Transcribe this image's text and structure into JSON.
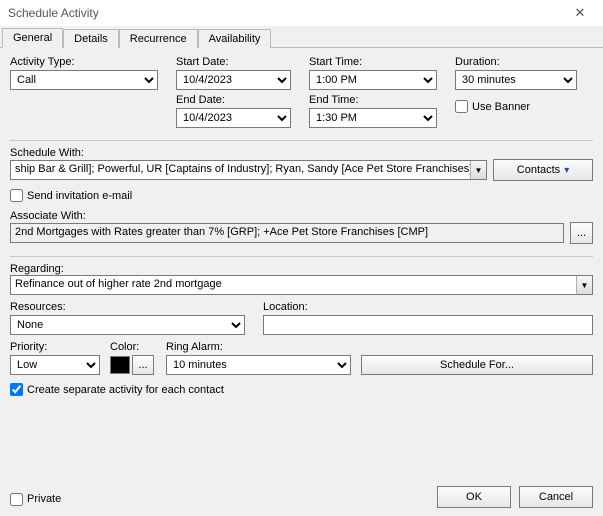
{
  "window": {
    "title": "Schedule Activity",
    "close": "✕"
  },
  "tabs": [
    "General",
    "Details",
    "Recurrence",
    "Availability"
  ],
  "fields": {
    "activity_type": {
      "label": "Activity Type:",
      "value": "Call"
    },
    "start_date": {
      "label": "Start Date:",
      "value": "10/4/2023"
    },
    "end_date": {
      "label": "End Date:",
      "value": "10/4/2023"
    },
    "start_time": {
      "label": "Start Time:",
      "value": "1:00 PM"
    },
    "end_time": {
      "label": "End Time:",
      "value": "1:30 PM"
    },
    "duration": {
      "label": "Duration:",
      "value": "30 minutes"
    },
    "use_banner": {
      "label": "Use Banner"
    },
    "schedule_with": {
      "label": "Schedule With:",
      "value": "ship Bar & Grill]; Powerful, UR [Captains of Industry]; Ryan, Sandy [Ace Pet Store Franchises]",
      "button": "Contacts"
    },
    "send_invite": {
      "label": "Send invitation e-mail"
    },
    "associate_with": {
      "label": "Associate With:",
      "value": "2nd Mortgages with Rates greater than 7% [GRP]; +Ace Pet Store Franchises [CMP]",
      "button": "..."
    },
    "regarding": {
      "label": "Regarding:",
      "value": "Refinance out of higher rate 2nd mortgage"
    },
    "resources": {
      "label": "Resources:",
      "value": "None"
    },
    "location": {
      "label": "Location:",
      "value": ""
    },
    "priority": {
      "label": "Priority:",
      "value": "Low"
    },
    "color": {
      "label": "Color:",
      "value": "#000000",
      "button": "..."
    },
    "ring_alarm": {
      "label": "Ring Alarm:",
      "value": "10 minutes"
    },
    "schedule_for": {
      "label": "Schedule For..."
    },
    "create_separate": {
      "label": "Create separate activity for each contact"
    },
    "private": {
      "label": "Private"
    }
  },
  "buttons": {
    "ok": "OK",
    "cancel": "Cancel"
  }
}
